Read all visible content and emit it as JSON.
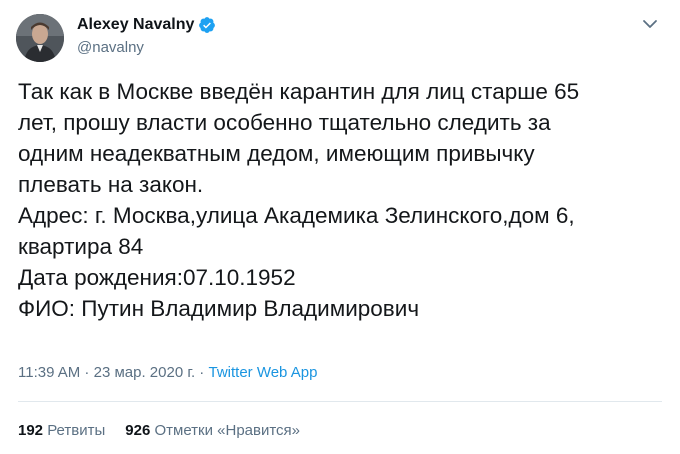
{
  "author": {
    "display_name": "Alexey Navalny",
    "handle": "@navalny",
    "verified_icon": "verified-badge-icon"
  },
  "tweet": {
    "lines": [
      "Так как в Москве введён карантин для лиц старше 65",
      "лет, прошу власти особенно тщательно следить за",
      "одним неадекватным дедом, имеющим привычку",
      "плевать на закон.",
      "Адрес: г. Москва,улица Академика Зелинского,дом 6,",
      "квартира 84",
      "Дата рождения:07.10.1952",
      "ФИО: Путин Владимир Владимирович"
    ]
  },
  "meta": {
    "time": "11:39 AM",
    "sep1": " · ",
    "date": "23 мар. 2020 г.",
    "sep2": " · ",
    "source": "Twitter Web App"
  },
  "stats": {
    "retweets_count": "192",
    "retweets_label": "Ретвиты",
    "likes_count": "926",
    "likes_label": "Отметки «Нравится»"
  },
  "colors": {
    "verified": "#1da1f2",
    "link": "#1b95e0",
    "muted": "#5b7083"
  }
}
